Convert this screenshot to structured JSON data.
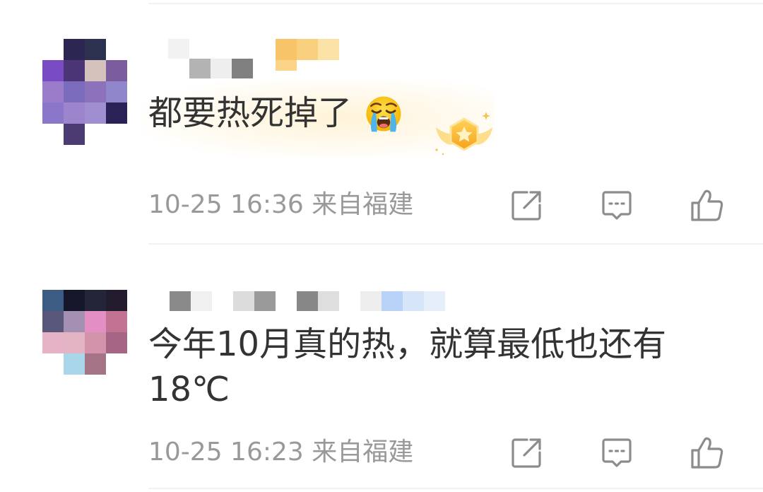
{
  "colors": {
    "background": "#ffffff",
    "text": "#333333",
    "meta": "#999999",
    "icon": "#8c8c8c",
    "divider": "#f2f2f2"
  },
  "comments": [
    {
      "avatar_mosaic": [
        [
          null,
          "#2b2752",
          "#2d3150",
          null
        ],
        [
          "#7a4cc4",
          "#4b3577",
          "#d6c2bd",
          "#7b5c9c"
        ],
        [
          "#9a7ccb",
          "#7c6cbd",
          "#8b72bb",
          "#8f86cb"
        ],
        [
          "#8a77c9",
          "#9d84cc",
          "#9f8fd0",
          "#2a2257"
        ],
        [
          null,
          "#4b3b72",
          null,
          null
        ]
      ],
      "username_mosaic": [
        [
          "#f2f2f2",
          null,
          null,
          null
        ],
        [
          null,
          "#b3b3b3",
          "#eeeeee",
          "#808080"
        ]
      ],
      "badge_mosaic": [
        [
          "#f7c46a",
          "#f9d07e",
          "#fbe2a6"
        ],
        [
          "#fbd488",
          null,
          null
        ]
      ],
      "text": "都要热死掉了",
      "emoji_icon": "loudly-crying-face-icon",
      "medal_icon": "star-medal-icon",
      "timestamp": "10-25 16:36",
      "location": "来自福建",
      "actions": {
        "share": "share-icon",
        "comment": "comment-icon",
        "like": "thumbs-up-icon"
      }
    },
    {
      "avatar_mosaic": [
        [
          "#3c5c84",
          "#16162a",
          "#25253a",
          "#231c2e"
        ],
        [
          "#5a587a",
          "#a390b3",
          "#e48fc3",
          "#c27394"
        ],
        [
          "#e6b2c6",
          "#e2b4c4",
          "#d394ab",
          "#a66584"
        ],
        [
          null,
          "#a9d6e8",
          "#a47486",
          null
        ]
      ],
      "username_mosaic": [
        [
          "#8a8a8a",
          "#f0f0f0",
          null,
          "#dcdcdc",
          "#9a9a9a",
          null,
          "#878787",
          "#dedede",
          null,
          "#eeeeee",
          "#b9d2f7",
          "#d6e5f8",
          "#e6eefa"
        ]
      ],
      "text_lines": [
        "今年10月真的热，就算最低也还有",
        "18℃"
      ],
      "timestamp": "10-25 16:23",
      "location": "来自福建",
      "actions": {
        "share": "share-icon",
        "comment": "comment-icon",
        "like": "thumbs-up-icon"
      }
    }
  ]
}
